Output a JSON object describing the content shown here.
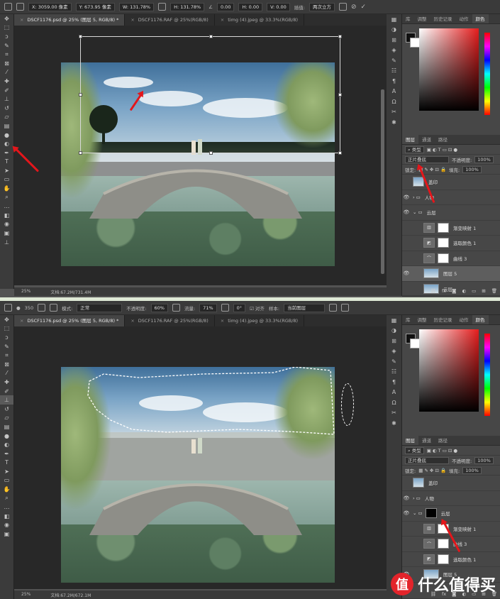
{
  "shot1": {
    "options": {
      "x": "X: 3059.00 像素",
      "y": "Y: 673.95 像素",
      "w": "W: 131.78%",
      "h": "H: 131.78%",
      "angle": "0.00",
      "h_skew": "H: 0.00",
      "v_skew": "V: 0.00",
      "interp_label": "插值:",
      "interp": "两次立方"
    },
    "tabs": [
      "DSCF1176.psd @ 25% (图层 5, RGB/8) *",
      "DSCF1176.RAF @ 25%(RGB/8)",
      "timg (4).jpeg @ 33.3%(RGB/8)"
    ],
    "status": {
      "zoom": "25%",
      "doc": "文档:67.2M/731.4M"
    },
    "panel_tabs": [
      "库",
      "调整",
      "历史记录",
      "动作",
      "颜色"
    ],
    "layer_tabs": [
      "图层",
      "通道",
      "路径"
    ],
    "kind_label": "类型",
    "blend": "正片叠底",
    "opacity_label": "不透明度:",
    "opacity": "100%",
    "lock_label": "锁定:",
    "fill_label": "填充:",
    "fill": "100%",
    "layers": [
      {
        "name": "盖印"
      },
      {
        "name": "人物"
      },
      {
        "name": "云层"
      },
      {
        "name": "渐变映射 1"
      },
      {
        "name": "选取颜色 1"
      },
      {
        "name": "曲线 3"
      },
      {
        "name": "图层 5"
      },
      {
        "name": "云层"
      }
    ]
  },
  "shot2": {
    "options": {
      "brush_size": "350",
      "mode_label": "模式:",
      "mode": "正常",
      "opacity_label": "不透明度:",
      "opacity": "60%",
      "flow_label": "流量:",
      "flow": "71%",
      "angle": "0°",
      "align": "对齐",
      "sample_label": "样本:",
      "sample": "当前图层"
    },
    "tabs": [
      "DSCF1176.psd @ 25% (图层 5, RGB/8) *",
      "DSCF1176.RAF @ 25%(RGB/8)",
      "timg (4).jpeg @ 33.3%(RGB/8)"
    ],
    "status": {
      "zoom": "25%",
      "doc": "文档:67.2M/672.1M"
    },
    "panel_tabs": [
      "库",
      "调整",
      "历史记录",
      "动作",
      "颜色"
    ],
    "layer_tabs": [
      "图层",
      "通道",
      "路径"
    ],
    "kind_label": "类型",
    "blend": "正片叠底",
    "opacity_label": "不透明度:",
    "opacity": "100%",
    "lock_label": "锁定:",
    "fill_label": "填充:",
    "fill": "100%",
    "layers": [
      {
        "name": "盖印"
      },
      {
        "name": "人物"
      },
      {
        "name": "云层"
      },
      {
        "name": "渐变映射 1"
      },
      {
        "name": "曲线 3"
      },
      {
        "name": "选取颜色 1"
      },
      {
        "name": "图层 5"
      }
    ]
  },
  "watermark": {
    "glyph": "值",
    "text": "什么值得买"
  },
  "colors": {
    "arrow": "#e3161b",
    "ui_bg": "#535353",
    "panel": "#474747",
    "canvas": "#282828"
  }
}
